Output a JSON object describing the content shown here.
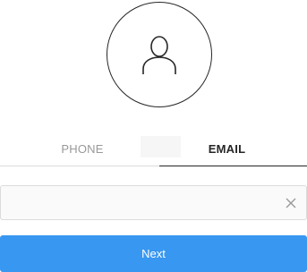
{
  "avatar": {
    "icon": "user-outline-icon"
  },
  "tabs": [
    {
      "label": "PHONE",
      "active": false
    },
    {
      "label": "EMAIL",
      "active": true
    }
  ],
  "email_field": {
    "value": "",
    "placeholder": "",
    "clear_icon": "close-icon"
  },
  "next_button": {
    "label": "Next"
  },
  "colors": {
    "accent": "#3897f0",
    "text_active": "#262626",
    "text_inactive": "#999999",
    "border": "#dbdbdb",
    "field_bg": "#fafafa"
  }
}
